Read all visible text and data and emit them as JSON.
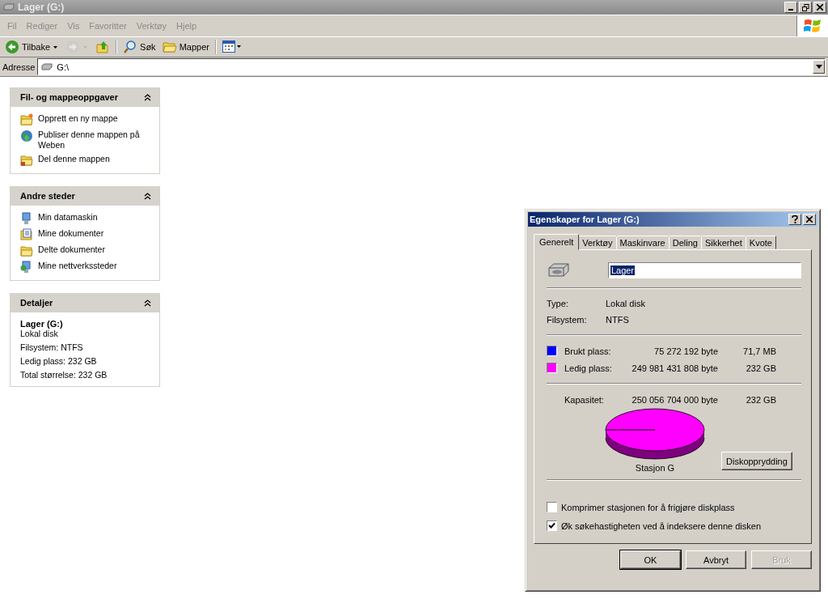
{
  "window": {
    "title": "Lager (G:)"
  },
  "menu": [
    "Fil",
    "Rediger",
    "Vis",
    "Favoritter",
    "Verktøy",
    "Hjelp"
  ],
  "toolbar": [
    {
      "kind": "back",
      "label": "Tilbake",
      "disabled": false
    },
    {
      "kind": "forward",
      "disabled": true
    },
    {
      "kind": "up",
      "disabled": false
    },
    {
      "kind": "search",
      "label": "Søk",
      "disabled": false
    },
    {
      "kind": "folders",
      "label": "Mapper",
      "disabled": false
    },
    {
      "kind": "views",
      "disabled": false
    }
  ],
  "address": {
    "label": "Adresse",
    "value": "G:\\"
  },
  "panels": [
    {
      "kind": "links",
      "title": "Fil- og mappeoppgaver",
      "items": [
        {
          "kind": "new-folder",
          "label": "Opprett en ny mappe"
        },
        {
          "kind": "globe",
          "label": "Publiser denne mappen på Weben"
        },
        {
          "kind": "share",
          "label": "Del denne mappen"
        }
      ]
    },
    {
      "kind": "links",
      "title": "Andre steder",
      "items": [
        {
          "kind": "computer",
          "label": "Min datamaskin"
        },
        {
          "kind": "documents",
          "label": "Mine dokumenter"
        },
        {
          "kind": "folder",
          "label": "Delte dokumenter"
        },
        {
          "kind": "network",
          "label": "Mine nettverkssteder"
        }
      ]
    },
    {
      "kind": "details",
      "title": "Detaljer",
      "name": "Lager (G:)",
      "lines": [
        "Lokal disk",
        "Filsystem: NTFS",
        "Ledig plass: 232 GB",
        "Total størrelse: 232 GB"
      ]
    }
  ],
  "dialog": {
    "title": "Egenskaper for Lager (G:)",
    "tabs": [
      {
        "label": "Generelt",
        "selected": true
      },
      {
        "label": "Verktøy",
        "selected": false
      },
      {
        "label": "Maskinvare",
        "selected": false
      },
      {
        "label": "Deling",
        "selected": false
      },
      {
        "label": "Sikkerhet",
        "selected": false
      },
      {
        "label": "Kvote",
        "selected": false
      }
    ],
    "name_value": "Lager",
    "info": [
      {
        "label": "Type:",
        "value": "Lokal disk"
      },
      {
        "label": "Filsystem:",
        "value": "NTFS"
      }
    ],
    "usage": [
      {
        "label": "Brukt plass:",
        "color": "#0000ff",
        "bytes": "75 272 192 byte",
        "size": "71,7 MB"
      },
      {
        "label": "Ledig plass:",
        "color": "#ff00ff",
        "bytes": "249 981 431 808 byte",
        "size": "232 GB"
      }
    ],
    "capacity": {
      "label": "Kapasitet:",
      "bytes": "250 056 704 000 byte",
      "size": "232 GB"
    },
    "drive_label": "Stasjon G",
    "cleanup": "Diskopprydding",
    "options": [
      {
        "label": "Komprimer stasjonen for å frigjøre diskplass",
        "checked": false
      },
      {
        "label": "Øk søkehastigheten ved å indeksere denne disken",
        "checked": true
      }
    ],
    "buttons": [
      {
        "label": "OK",
        "disabled": false,
        "default": true
      },
      {
        "label": "Avbryt",
        "disabled": false,
        "default": false
      },
      {
        "label": "Bruk",
        "disabled": true,
        "default": false
      }
    ]
  }
}
